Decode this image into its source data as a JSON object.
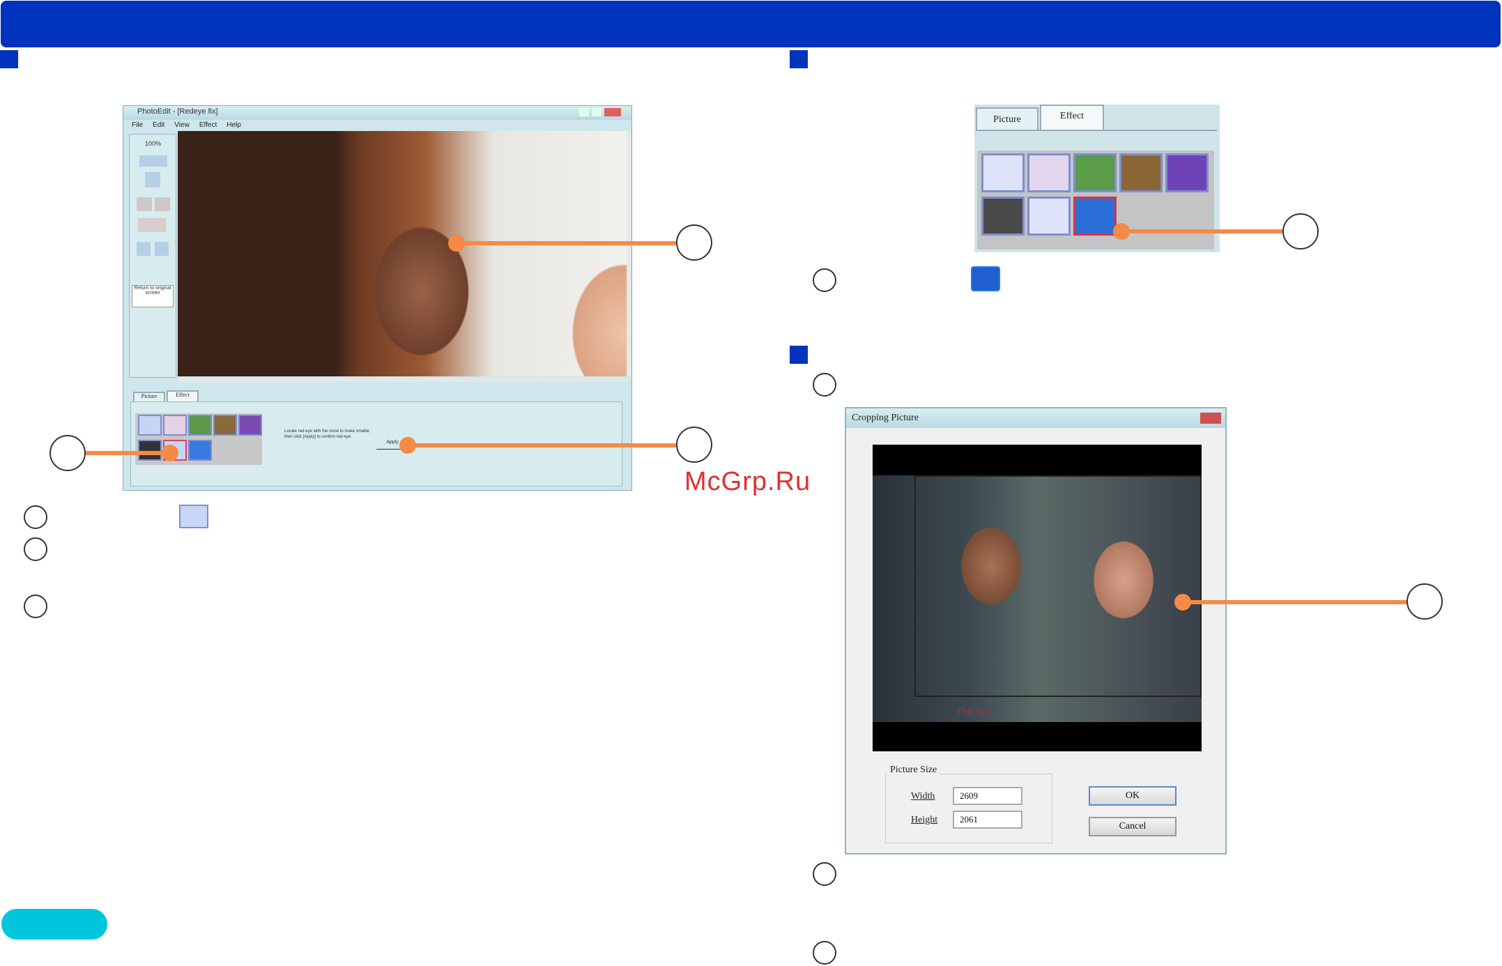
{
  "watermark": "McGrp.Ru",
  "window": {
    "title": "PhotoEdit - [Redeye fix]",
    "menu": [
      "File",
      "Edit",
      "View",
      "Effect",
      "Help"
    ],
    "tabs": [
      "Picture",
      "Effect"
    ],
    "sidebar": {
      "zoom": "100%",
      "return_label": "Return to original screen"
    },
    "status_text": "Locate red-eye with the circle to make smaller, then click [Apply] to confirm red-eye.",
    "apply_label": "Apply"
  },
  "effect_panel": {
    "tabs": [
      "Picture",
      "Effect"
    ]
  },
  "crop_dialog": {
    "title": "Cropping Picture",
    "group_label": "Picture Size",
    "width_label": "Width",
    "width_value": "2609",
    "height_label": "Height",
    "height_value": "2061",
    "ok_label": "OK",
    "cancel_label": "Cancel",
    "shirt_text": "The sun"
  },
  "colors": {
    "accent": "#0033bb",
    "callout": "#f58a46",
    "pill": "#00c6dd",
    "watermark": "#e03030"
  }
}
